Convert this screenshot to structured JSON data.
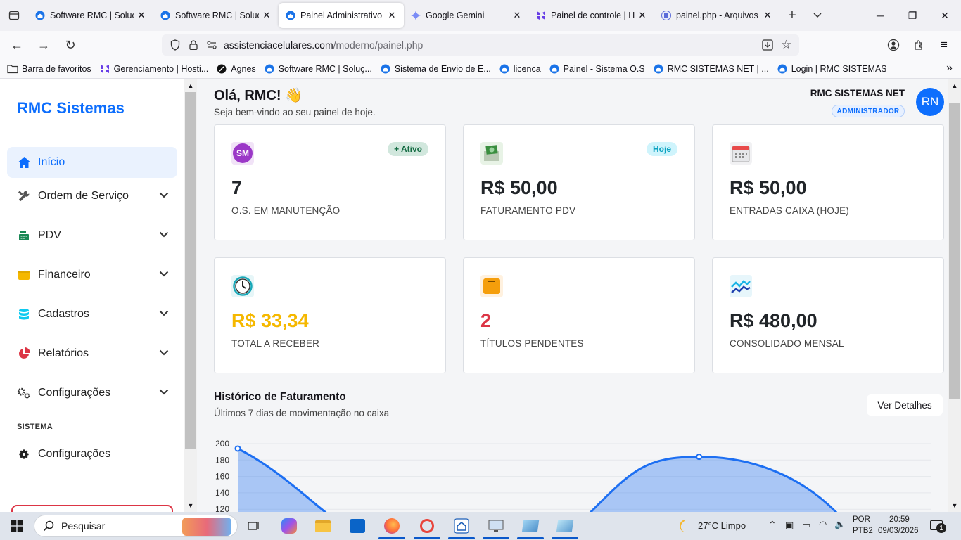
{
  "browser": {
    "tabs": [
      {
        "title": "Software RMC | Soluçõ",
        "active": false,
        "icon": "house-globe-icon"
      },
      {
        "title": "Software RMC | Soluçõ",
        "active": false,
        "icon": "house-globe-icon"
      },
      {
        "title": "Painel Administrativo -",
        "active": true,
        "icon": "house-globe-icon"
      },
      {
        "title": "Google Gemini",
        "active": false,
        "icon": "gemini-icon"
      },
      {
        "title": "Painel de controle | Ho",
        "active": false,
        "icon": "hostinger-icon"
      },
      {
        "title": "painel.php - Arquivos -",
        "active": false,
        "icon": "file-icon"
      }
    ],
    "url_host": "assistenciacelulares.com",
    "url_path": "/moderno/painel.php",
    "bookmarks": [
      {
        "label": "Barra de favoritos",
        "icon": "folder-icon"
      },
      {
        "label": "Gerenciamento | Hosti...",
        "icon": "hostinger-icon"
      },
      {
        "label": "Agnes",
        "icon": "agnes-icon"
      },
      {
        "label": "Software RMC | Soluç...",
        "icon": "house-globe-icon"
      },
      {
        "label": "Sistema de Envio de E...",
        "icon": "house-globe-icon"
      },
      {
        "label": "licenca",
        "icon": "house-globe-icon"
      },
      {
        "label": "Painel - Sistema O.S",
        "icon": "house-globe-icon"
      },
      {
        "label": "RMC SISTEMAS NET | ...",
        "icon": "house-globe-icon"
      },
      {
        "label": "Login | RMC SISTEMAS",
        "icon": "house-globe-icon"
      }
    ]
  },
  "sidebar": {
    "brand": "RMC Sistemas",
    "items": [
      {
        "label": "Início",
        "icon": "home-icon",
        "active": true,
        "has_chevron": false
      },
      {
        "label": "Ordem de Serviço",
        "icon": "tools-icon",
        "active": false,
        "has_chevron": true
      },
      {
        "label": "PDV",
        "icon": "cash-register-icon",
        "active": false,
        "has_chevron": true
      },
      {
        "label": "Financeiro",
        "icon": "wallet-icon",
        "active": false,
        "has_chevron": true
      },
      {
        "label": "Cadastros",
        "icon": "database-icon",
        "active": false,
        "has_chevron": true
      },
      {
        "label": "Relatórios",
        "icon": "pie-chart-icon",
        "active": false,
        "has_chevron": true
      },
      {
        "label": "Configurações",
        "icon": "gears-icon",
        "active": false,
        "has_chevron": true
      }
    ],
    "section_title": "SISTEMA",
    "system_item": {
      "label": "Configurações",
      "icon": "gear-icon"
    }
  },
  "header": {
    "greeting": "Olá, RMC! 👋",
    "subtitle": "Seja bem-vindo ao seu painel de hoje.",
    "user_name": "RMC SISTEMAS NET",
    "user_role": "ADMINISTRADOR",
    "avatar_initials": "RN"
  },
  "cards": [
    {
      "value": "7",
      "label": "O.S. EM MANUTENÇÃO",
      "badge": "+ Ativo",
      "icon": "sm-badge-icon",
      "value_color": "#212529"
    },
    {
      "value": "R$ 50,00",
      "label": "FATURAMENTO PDV",
      "badge": "Hoje",
      "icon": "money-icon",
      "value_color": "#212529"
    },
    {
      "value": "R$ 50,00",
      "label": "ENTRADAS CAIXA (HOJE)",
      "badge": "",
      "icon": "calendar-icon",
      "value_color": "#212529"
    },
    {
      "value": "R$ 33,34",
      "label": "TOTAL A RECEBER",
      "badge": "",
      "icon": "clock-icon",
      "value_color": "#f5b800"
    },
    {
      "value": "2",
      "label": "TÍTULOS PENDENTES",
      "badge": "",
      "icon": "folder-square-icon",
      "value_color": "#dc3545"
    },
    {
      "value": "R$ 480,00",
      "label": "CONSOLIDADO MENSAL",
      "badge": "",
      "icon": "trend-chart-icon",
      "value_color": "#212529"
    }
  ],
  "history": {
    "title": "Histórico de Faturamento",
    "subtitle": "Últimos 7 dias de movimentação no caixa",
    "details_button": "Ver Detalhes"
  },
  "chart_data": {
    "type": "area",
    "y_ticks": [
      120,
      140,
      160,
      180,
      200
    ],
    "ylim": [
      120,
      200
    ],
    "series": [
      {
        "values": [
          194,
          0,
          0,
          184,
          0
        ]
      }
    ],
    "x_visible_fractions": [
      0.0,
      0.25,
      0.5,
      0.75,
      1.0
    ],
    "grid": true,
    "color": "#1d6ff2"
  },
  "taskbar": {
    "search_placeholder": "Pesquisar",
    "weather": "27°C  Limpo",
    "lang_top": "POR",
    "lang_bottom": "PTB2",
    "time": "20:59",
    "date": "09/03/2026",
    "notifications": "1"
  }
}
